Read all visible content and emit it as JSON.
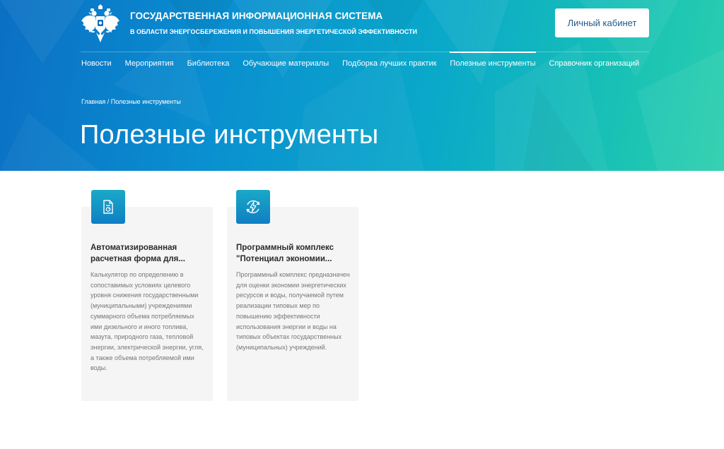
{
  "header": {
    "title": "ГОСУДАРСТВЕННАЯ ИНФОРМАЦИОННАЯ СИСТЕМА",
    "subtitle": "В ОБЛАСТИ ЭНЕРГОСБЕРЕЖЕНИЯ И ПОВЫШЕНИЯ ЭНЕРГЕТИЧЕСКОЙ ЭФФЕКТИВНОСТИ",
    "cabinet_label": "Личный кабинет",
    "emblem_icon": "coat-of-arms-icon"
  },
  "nav": {
    "items": [
      {
        "label": "Новости",
        "active": false
      },
      {
        "label": "Мероприятия",
        "active": false
      },
      {
        "label": "Библиотека",
        "active": false
      },
      {
        "label": "Обучающие материалы",
        "active": false
      },
      {
        "label": "Подборка лучших практик",
        "active": false
      },
      {
        "label": "Полезные инструменты",
        "active": true
      },
      {
        "label": "Справочник организаций",
        "active": false
      }
    ]
  },
  "breadcrumb": {
    "home": "Главная",
    "separator": " / ",
    "current": "Полезные инструменты"
  },
  "page": {
    "title": "Полезные инструменты"
  },
  "cards": [
    {
      "icon": "document-calculator-icon",
      "title": "Автоматизированная расчетная форма для...",
      "description": "Калькулятор по определению в сопоставимых условиях целевого уровня снижения государственными (муниципальными) учреждениями суммарного объема потребляемых ими дизельного и иного топлива, мазута, природного газа, тепловой энергии, электрической энергии, угля, а также объема потребляемой ими воды."
    },
    {
      "icon": "energy-cycle-icon",
      "title": "Программный комплекс \"Потенциал экономии...",
      "description": "Программный комплекс предназначен для оценки экономии энергетических ресурсов и воды, получаемой путем реализации типовых мер по повышению эффективности использования энергии и воды на типовых объектах государственных (муниципальных) учреждений."
    }
  ],
  "colors": {
    "gradient_start": "#0b6fc4",
    "gradient_end": "#2bcfae",
    "card_bg": "#f5f5f5",
    "icon_tile": "#1aa9c6"
  }
}
